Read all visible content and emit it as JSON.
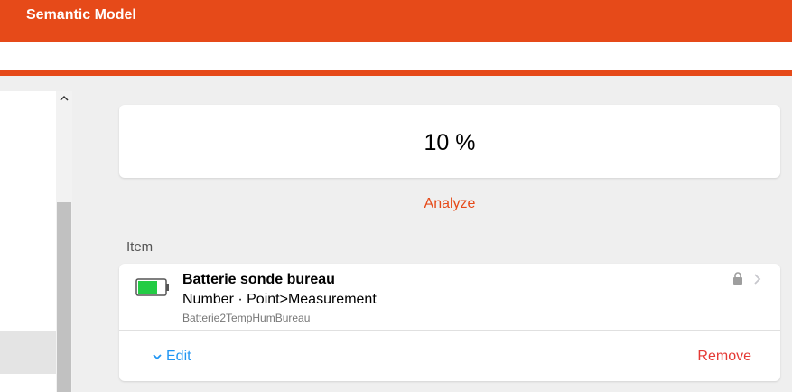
{
  "navbar": {
    "title": "Semantic Model"
  },
  "state_card": {
    "value": "10 %"
  },
  "analyze": {
    "label": "Analyze"
  },
  "item_section": {
    "title": "Item"
  },
  "item": {
    "label": "Batterie sonde bureau",
    "type": "Number · Point>Measurement",
    "name": "Batterie2TempHumBureau",
    "icon": "battery-icon",
    "edit_label": "Edit",
    "remove_label": "Remove"
  },
  "colors": {
    "accent": "#e64a19",
    "link_blue": "#2196f3",
    "remove_red": "#e53935",
    "battery_green": "#22cc44"
  }
}
